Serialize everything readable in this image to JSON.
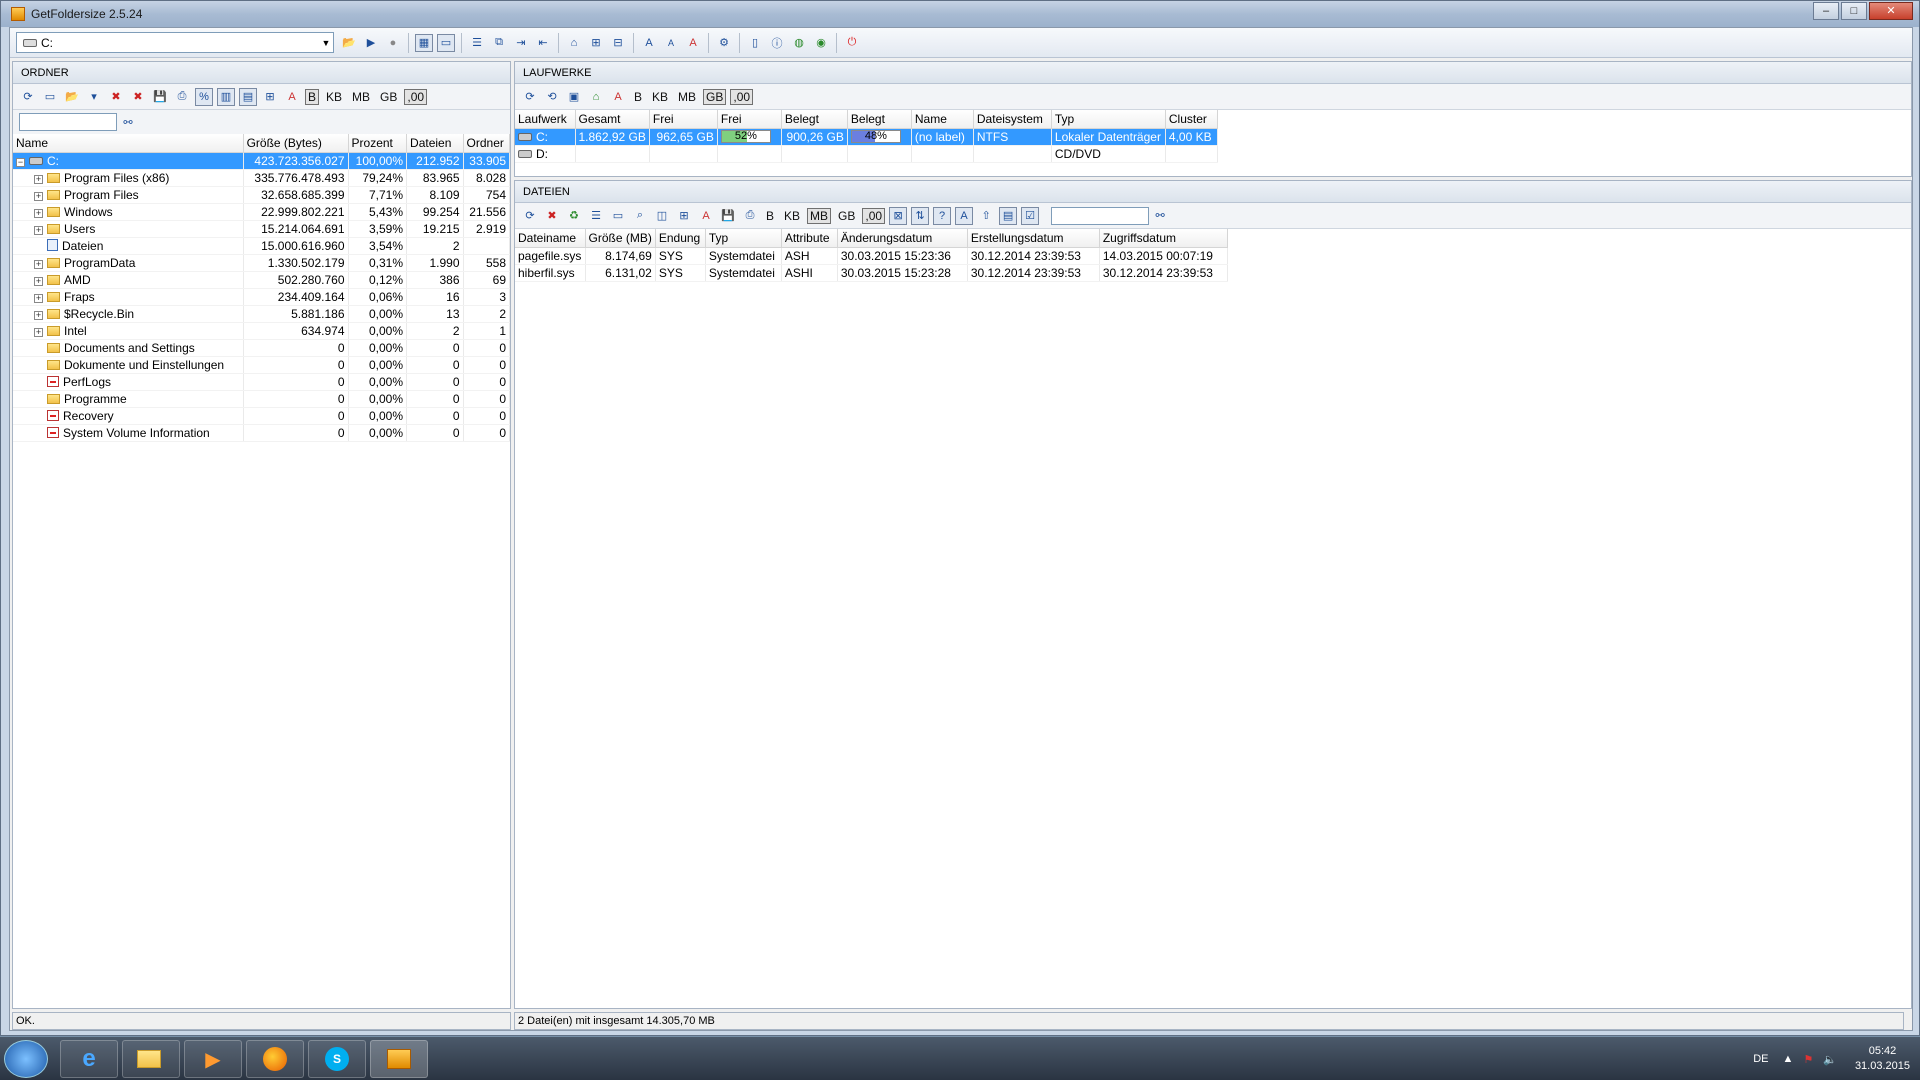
{
  "window": {
    "title": "GetFoldersize 2.5.24",
    "min": "–",
    "max": "□",
    "close": "✕"
  },
  "toolbar": {
    "drive_value": "C:"
  },
  "folders": {
    "header": "ORDNER",
    "units": [
      "B",
      "KB",
      "MB",
      "GB",
      ",00"
    ],
    "search_placeholder": "",
    "columns": [
      "Name",
      "Größe (Bytes)",
      "Prozent",
      "Dateien",
      "Ordner"
    ],
    "rows": [
      {
        "name": "C:",
        "size": "423.723.356.027",
        "pct": "100,00%",
        "files": "212.952",
        "dirs": "33.905",
        "kind": "drive"
      },
      {
        "name": "Program Files (x86)",
        "size": "335.776.478.493",
        "pct": "79,24%",
        "files": "83.965",
        "dirs": "8.028",
        "kind": "folder"
      },
      {
        "name": "Program Files",
        "size": "32.658.685.399",
        "pct": "7,71%",
        "files": "8.109",
        "dirs": "754",
        "kind": "folder"
      },
      {
        "name": "Windows",
        "size": "22.999.802.221",
        "pct": "5,43%",
        "files": "99.254",
        "dirs": "21.556",
        "kind": "folder"
      },
      {
        "name": "Users",
        "size": "15.214.064.691",
        "pct": "3,59%",
        "files": "19.215",
        "dirs": "2.919",
        "kind": "folder"
      },
      {
        "name": "Dateien",
        "size": "15.000.616.960",
        "pct": "3,54%",
        "files": "2",
        "dirs": "",
        "kind": "files"
      },
      {
        "name": "ProgramData",
        "size": "1.330.502.179",
        "pct": "0,31%",
        "files": "1.990",
        "dirs": "558",
        "kind": "folder"
      },
      {
        "name": "AMD",
        "size": "502.280.760",
        "pct": "0,12%",
        "files": "386",
        "dirs": "69",
        "kind": "folder"
      },
      {
        "name": "Fraps",
        "size": "234.409.164",
        "pct": "0,06%",
        "files": "16",
        "dirs": "3",
        "kind": "folder"
      },
      {
        "name": "$Recycle.Bin",
        "size": "5.881.186",
        "pct": "0,00%",
        "files": "13",
        "dirs": "2",
        "kind": "folder"
      },
      {
        "name": "Intel",
        "size": "634.974",
        "pct": "0,00%",
        "files": "2",
        "dirs": "1",
        "kind": "folder"
      },
      {
        "name": "Documents and Settings",
        "size": "0",
        "pct": "0,00%",
        "files": "0",
        "dirs": "0",
        "kind": "link"
      },
      {
        "name": "Dokumente und Einstellungen",
        "size": "0",
        "pct": "0,00%",
        "files": "0",
        "dirs": "0",
        "kind": "link"
      },
      {
        "name": "PerfLogs",
        "size": "0",
        "pct": "0,00%",
        "files": "0",
        "dirs": "0",
        "kind": "denied"
      },
      {
        "name": "Programme",
        "size": "0",
        "pct": "0,00%",
        "files": "0",
        "dirs": "0",
        "kind": "link"
      },
      {
        "name": "Recovery",
        "size": "0",
        "pct": "0,00%",
        "files": "0",
        "dirs": "0",
        "kind": "denied"
      },
      {
        "name": "System Volume Information",
        "size": "0",
        "pct": "0,00%",
        "files": "0",
        "dirs": "0",
        "kind": "denied"
      }
    ],
    "status": "OK."
  },
  "drives": {
    "header": "LAUFWERKE",
    "units": [
      "B",
      "KB",
      "MB",
      "GB",
      ",00"
    ],
    "columns": [
      "Laufwerk",
      "Gesamt",
      "Frei",
      "Frei",
      "Belegt",
      "Belegt",
      "Name",
      "Dateisystem",
      "Typ",
      "Cluster"
    ],
    "rows": [
      {
        "drive": "C:",
        "total": "1.862,92 GB",
        "free": "962,65 GB",
        "free_pct": 0.52,
        "free_pct_label": "52%",
        "used": "900,26 GB",
        "used_pct": 0.48,
        "used_pct_label": "48%",
        "name": "(no label)",
        "fs": "NTFS",
        "type": "Lokaler Datenträger",
        "cluster": "4,00 KB"
      },
      {
        "drive": "D:",
        "total": "",
        "free": "",
        "free_pct_label": "",
        "used": "",
        "used_pct_label": "",
        "name": "",
        "fs": "",
        "type": "CD/DVD",
        "cluster": ""
      }
    ],
    "free_color": "#7fd07f",
    "used_color": "#6b7fe0"
  },
  "files": {
    "header": "DATEIEN",
    "units": [
      "B",
      "KB",
      "MB",
      "GB",
      ",00"
    ],
    "search_placeholder": "",
    "columns": [
      "Dateiname",
      "Größe (MB)",
      "Endung",
      "Typ",
      "Attribute",
      "Änderungsdatum",
      "Erstellungsdatum",
      "Zugriffsdatum"
    ],
    "rows": [
      {
        "name": "pagefile.sys",
        "size": "8.174,69",
        "ext": "SYS",
        "type": "Systemdatei",
        "attr": "ASH",
        "mod": "30.03.2015 15:23:36",
        "created": "30.12.2014 23:39:53",
        "access": "14.03.2015 00:07:19"
      },
      {
        "name": "hiberfil.sys",
        "size": "6.131,02",
        "ext": "SYS",
        "type": "Systemdatei",
        "attr": "ASHI",
        "mod": "30.03.2015 15:23:28",
        "created": "30.12.2014 23:39:53",
        "access": "30.12.2014 23:39:53"
      }
    ],
    "status": "2 Datei(en) mit insgesamt 14.305,70 MB"
  },
  "tray": {
    "lang": "DE",
    "time": "05:42",
    "date": "31.03.2015"
  }
}
